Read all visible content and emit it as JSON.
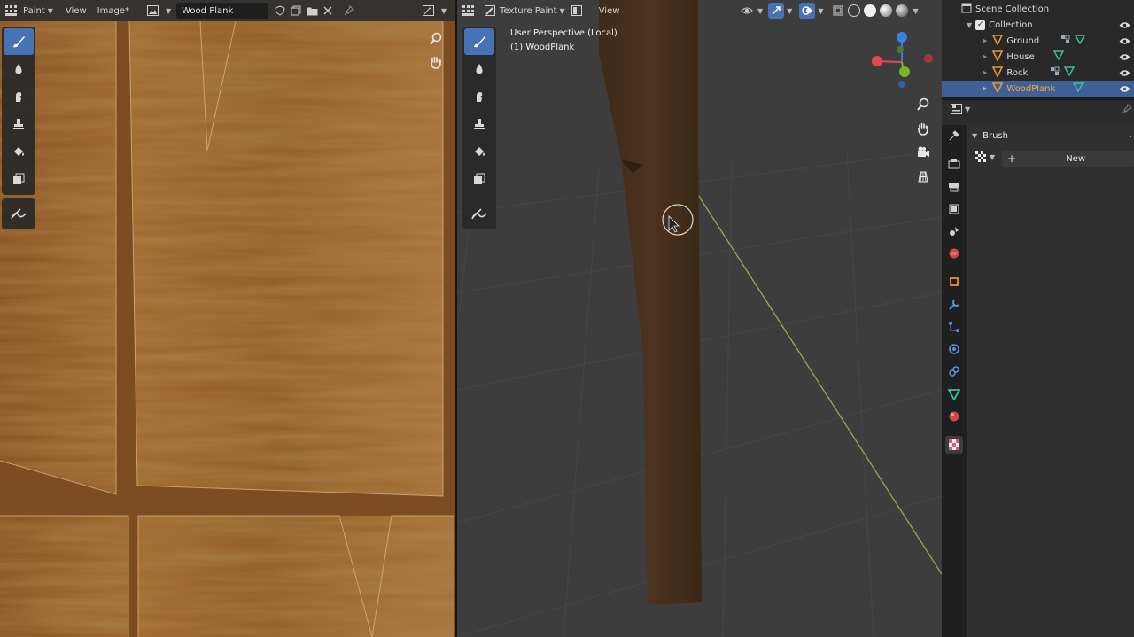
{
  "image_editor": {
    "mode_label": "Paint",
    "menu_view": "View",
    "menu_image": "Image*",
    "image_name": "Wood Plank"
  },
  "viewport": {
    "mode_label": "Texture Paint",
    "menu_view": "View",
    "perspective_label": "User Perspective (Local)",
    "object_label": "(1) WoodPlank",
    "gizmo_axes": {
      "x": "#e8474f",
      "y": "#7ab52a",
      "z": "#3b7ee8"
    }
  },
  "outliner": {
    "scene_collection": "Scene Collection",
    "collection": "Collection",
    "objects": [
      {
        "name": "Ground",
        "selected": false
      },
      {
        "name": "House",
        "selected": false
      },
      {
        "name": "Rock",
        "selected": false
      },
      {
        "name": "WoodPlank",
        "selected": true
      }
    ]
  },
  "properties": {
    "brush_panel": "Brush",
    "new_button": "New"
  },
  "colors": {
    "accent": "#4772b3",
    "selected_row": "#3f5f97",
    "selected_text": "#f5a742",
    "mesh_icon": "#3fbfa0",
    "object_icon": "#e8943a"
  }
}
